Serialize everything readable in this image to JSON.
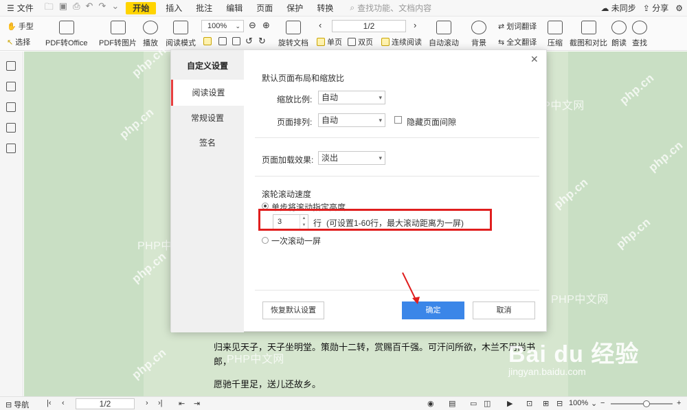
{
  "menubar": {
    "file_label": "文件",
    "tabs": [
      "开始",
      "插入",
      "批注",
      "编辑",
      "页面",
      "保护",
      "转换"
    ],
    "search_placeholder": "查找功能、文档内容",
    "sync_label": "未同步",
    "share_label": "分享"
  },
  "toolbar": {
    "hand_tool": "手型",
    "select_tool": "选择",
    "pdf_to_office": "PDF转Office",
    "pdf_to_image": "PDF转图片",
    "play": "播放",
    "read_mode": "阅读模式",
    "zoom_value": "100%",
    "rotate_doc": "旋转文档",
    "page_value": "1/2",
    "single_page": "单页",
    "double_page": "双页",
    "continuous_read": "连续阅读",
    "auto_scroll": "自动滚动",
    "background": "背景",
    "word_translate": "划词翻译",
    "full_translate": "全文翻译",
    "compress": "压缩",
    "screenshot_compare": "截图和对比",
    "read_aloud": "朗读",
    "find": "查找"
  },
  "dialog": {
    "title": "自定义设置",
    "nav": [
      "阅读设置",
      "常规设置",
      "签名"
    ],
    "section_default_layout": "默认页面布局和缩放比",
    "zoom_label": "缩放比例:",
    "zoom_value": "自动",
    "arrange_label": "页面排列:",
    "arrange_value": "自动",
    "hide_gap_label": "隐藏页面间隙",
    "load_effect_label": "页面加载效果:",
    "load_effect_value": "淡出",
    "scroll_speed_title": "滚轮滚动速度",
    "option_fixed_height": "单步将滚动指定高度",
    "lines_value": "3",
    "lines_unit": "行",
    "lines_hint": "(可设置1-60行，最大滚动距离为一屏)",
    "option_one_screen": "一次滚动一屏",
    "restore_default": "恢复默认设置",
    "ok": "确定",
    "cancel": "取消"
  },
  "document": {
    "lines": [
      "归来见天子，天子坐明堂。策勋十二转，赏赐百千强。可汗问所欲，木兰不用尚书郎，",
      "愿驰千里足，送儿还故乡。"
    ]
  },
  "statusbar": {
    "nav_label": "导航",
    "page_value": "1/2",
    "zoom_value": "100%",
    "zoom_slider_fraction": 0.58
  },
  "watermarks": {
    "php_cn": "PHP中文网",
    "php_rot": "php.cn",
    "baidu_logo": "Bai du 经验",
    "baidu_url": "jingyan.baidu.com"
  },
  "colors": {
    "accent_yellow": "#ffd400",
    "primary_blue": "#3b86e8",
    "highlight_red": "#e01e1e",
    "doc_background": "#c9dfc4"
  }
}
